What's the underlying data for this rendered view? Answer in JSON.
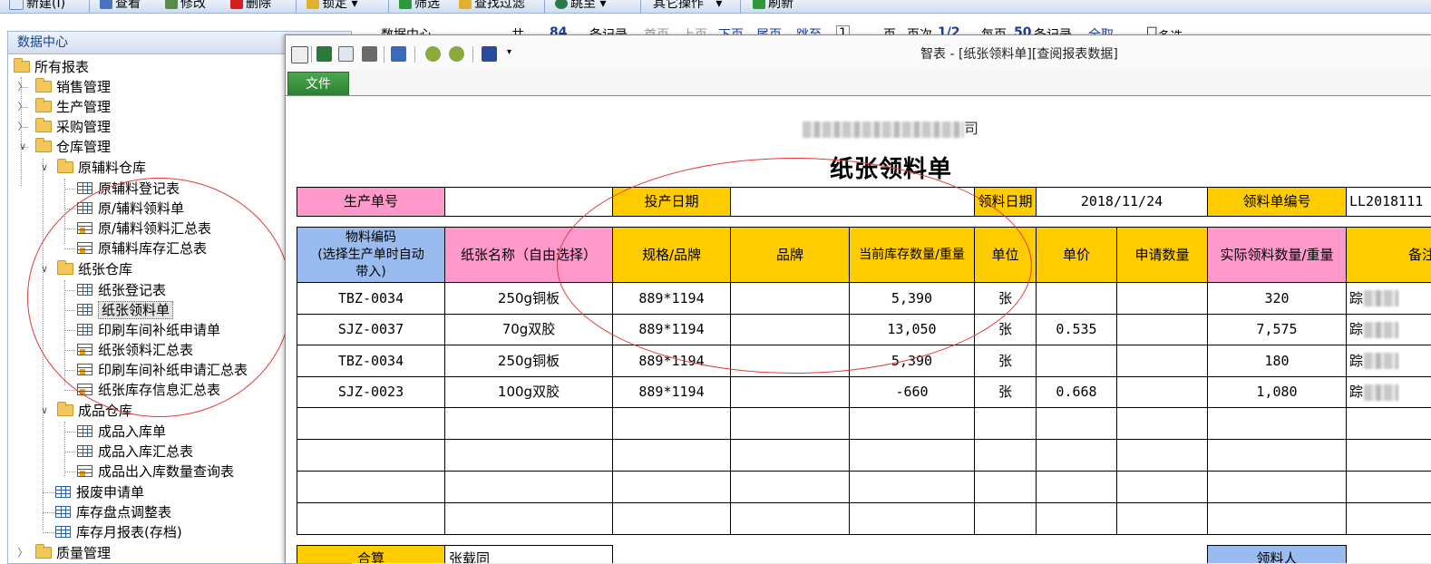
{
  "main_toolbar": {
    "items": [
      "新建(I)",
      "查看",
      "修改",
      "删除",
      "锁定",
      "筛选",
      "查找过滤",
      "跳至",
      "其它操作",
      "刷新"
    ]
  },
  "background_list": {
    "tab": "数据中心",
    "total_label": "共",
    "total_value": "84",
    "records": "条记录",
    "first": "首页",
    "prev": "上页",
    "next": "下页",
    "last": "尾页",
    "jump": "跳至",
    "page_value": "1",
    "page_suffix": "页",
    "page_count_label": "页次",
    "page_count": "1/2",
    "per_page_label": "每页",
    "per_page": "50",
    "per_page_suffix": "条记录",
    "all": "全取",
    "multi": "多选"
  },
  "tree": {
    "header": "数据中心",
    "root": "所有报表",
    "sales": "销售管理",
    "production": "生产管理",
    "purchase": "采购管理",
    "warehouse": "仓库管理",
    "raw_wh": "原辅料仓库",
    "raw_items": [
      "原辅料登记表",
      "原/辅料领料单",
      "原/辅料领料汇总表",
      "原辅料库存汇总表"
    ],
    "paper_wh": "纸张仓库",
    "paper_items": [
      "纸张登记表",
      "纸张领料单",
      "印刷车间补纸申请单",
      "纸张领料汇总表",
      "印刷车间补纸申请汇总表",
      "纸张库存信息汇总表"
    ],
    "finished_wh": "成品仓库",
    "finished_items": [
      "成品入库单",
      "成品入库汇总表",
      "成品出入库数量查询表"
    ],
    "wh_items": [
      "报废申请单",
      "库存盘点调整表",
      "库存月报表(存档)"
    ],
    "quality": "质量管理"
  },
  "report_window": {
    "title": "智表 - [纸张领料单][查阅报表数据]",
    "file_tab": "文件"
  },
  "report": {
    "company_suffix": "司",
    "title": "纸张领料单",
    "header_row": {
      "prod_no_label": "生产单号",
      "prod_no_value": "",
      "start_date_label": "投产日期",
      "start_date_value": "",
      "pick_date_label": "领料日期",
      "pick_date_value": "2018/11/24",
      "pick_no_label": "领料单编号",
      "pick_no_value": "LL2018111"
    },
    "columns": [
      "物料编码\n(选择生产单时自动\n带入)",
      "纸张名称（自由选择）",
      "规格/品牌",
      "品牌",
      "当前库存数量/重量",
      "单位",
      "单价",
      "申请数量",
      "实际领料数量/重量",
      "备注"
    ],
    "rows": [
      {
        "code": "TBZ-0034",
        "name": "250g铜板",
        "spec": "889*1194",
        "brand": "",
        "stock": "5,390",
        "unit": "张",
        "price": "",
        "apply": "",
        "actual": "320",
        "note": "踪"
      },
      {
        "code": "SJZ-0037",
        "name": "70g双胶",
        "spec": "889*1194",
        "brand": "",
        "stock": "13,050",
        "unit": "张",
        "price": "0.535",
        "apply": "",
        "actual": "7,575",
        "note": "踪"
      },
      {
        "code": "TBZ-0034",
        "name": "250g铜板",
        "spec": "889*1194",
        "brand": "",
        "stock": "5,390",
        "unit": "张",
        "price": "",
        "apply": "",
        "actual": "180",
        "note": "踪"
      },
      {
        "code": "SJZ-0023",
        "name": "100g双胶",
        "spec": "889*1194",
        "brand": "",
        "stock": "-660",
        "unit": "张",
        "price": "0.668",
        "apply": "",
        "actual": "1,080",
        "note": "踪"
      }
    ],
    "footer": {
      "total_label": "合算",
      "total_value": "张载同",
      "picker_label": "领料人"
    }
  },
  "colors": {
    "pink": "#ff99cc",
    "yellow": "#ffcc00",
    "blue": "#99bbee",
    "annotation": "#e23a3a",
    "file_tab": "#3a9a3f"
  }
}
